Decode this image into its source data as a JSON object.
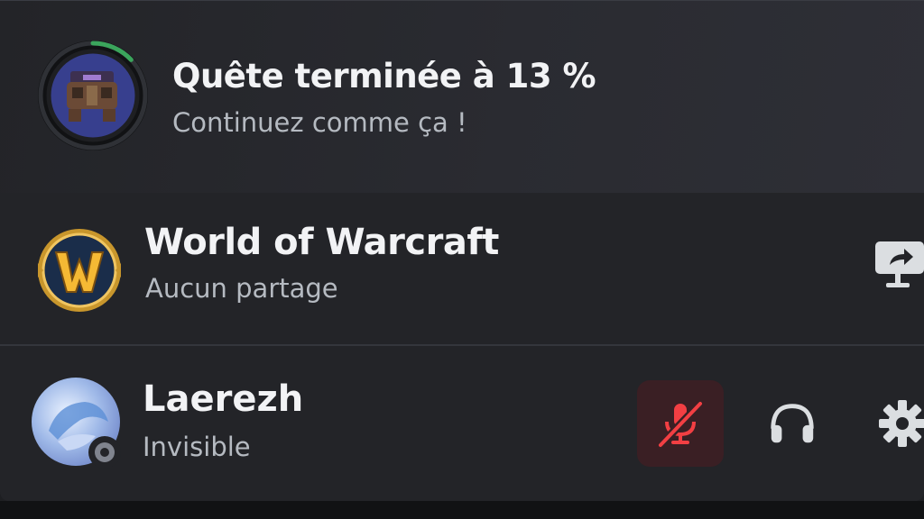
{
  "quest": {
    "title": "Quête terminée à 13 %",
    "subtitle": "Continuez comme ça !",
    "progress_percent": 13,
    "ring_color": "#3ba55c"
  },
  "activity": {
    "game_name": "World of Warcraft",
    "share_status": "Aucun partage",
    "share_icon": "screen-share-icon"
  },
  "user": {
    "name": "Laerezh",
    "status": "Invisible",
    "status_icon": "invisible-status-icon"
  },
  "controls": {
    "mic": {
      "icon": "microphone-muted-icon",
      "muted": true,
      "color": "#f23f43"
    },
    "headphones": {
      "icon": "headphones-icon"
    },
    "settings": {
      "icon": "gear-icon"
    }
  },
  "colors": {
    "panel_bg": "#232428",
    "muted_bg": "#3a1f24",
    "text_primary": "#f2f3f5",
    "text_secondary": "#b5bac1"
  }
}
